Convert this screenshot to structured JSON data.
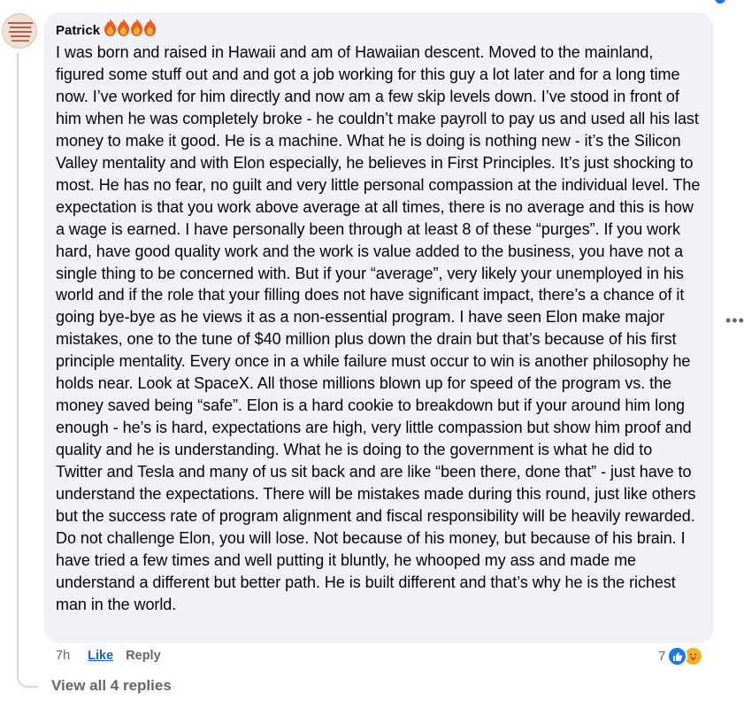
{
  "comment": {
    "author": "Patrick",
    "badge_icons": [
      "flame-icon",
      "flame-icon",
      "flame-icon",
      "flame-icon"
    ],
    "avatar_text": "I'M FULL OF RED AMERICAN BLOOD WHAT ARE YOU?",
    "text": "I was born and raised in Hawaii and am of Hawaiian descent. Moved to the mainland, figured some stuff out and and got a job working for this guy a lot later and for a long time now. I’ve worked for him directly and now am a few skip levels down. I’ve stood in front of him when he was completely broke - he couldn’t make payroll to pay us and used all his last money to make it good. He is a machine. What he is doing is nothing new - it’s the Silicon Valley mentality and with Elon especially, he believes in First Principles. It’s just shocking to most. He has no fear, no guilt and very little personal compassion at the individual level. The expectation is that you work above average at all times, there is no average and this is how a wage is earned. I have personally been through at least 8 of these “purges”. If you work hard, have good quality work and the work is value added to the business, you have not a single thing to be concerned with. But if your “average”, very likely your unemployed in his world and if the role that your filling does not have significant impact, there’s a chance of it going bye-bye as he views it as a non-essential program. I have seen Elon make major mistakes, one to the tune of $40 million plus down the drain but that’s because of his first principle mentality. Every once in a while failure must occur to win is another philosophy he holds near. Look at SpaceX. All those millions blown up for speed of the program vs. the money saved being “safe”. Elon is a hard cookie to breakdown but if your around him long enough - he’s is hard, expectations are high, very little compassion but show him proof and quality and he is understanding. What he is doing to the government is what he did to Twitter and Tesla and many of us sit back and are like “been there, done that” - just have to understand the expectations. There will be mistakes made during this round, just like others but the success rate of program alignment and fiscal responsibility will be heavily rewarded. Do not challenge Elon, you will lose. Not because of his money, but because of his brain. I have tried a few times and well putting it bluntly, he whooped my ass and made me understand a different but better path. He is built different and that’s why he is the richest man in the world.",
    "timestamp": "7h",
    "like_label": "Like",
    "reply_label": "Reply",
    "reaction_count": "7",
    "reaction_icons": [
      "thumbs-up-icon",
      "care-icon"
    ],
    "more_icon": "more-options-icon"
  },
  "replies": {
    "view_label": "View all 4 replies"
  },
  "colors": {
    "bubble": "#f0f2f5",
    "link_blue": "#1b64d6",
    "muted": "#65676b",
    "like_blue": "#1877f2",
    "care_yellow": "#f7b125",
    "flame_orange": "#f05a1a"
  }
}
